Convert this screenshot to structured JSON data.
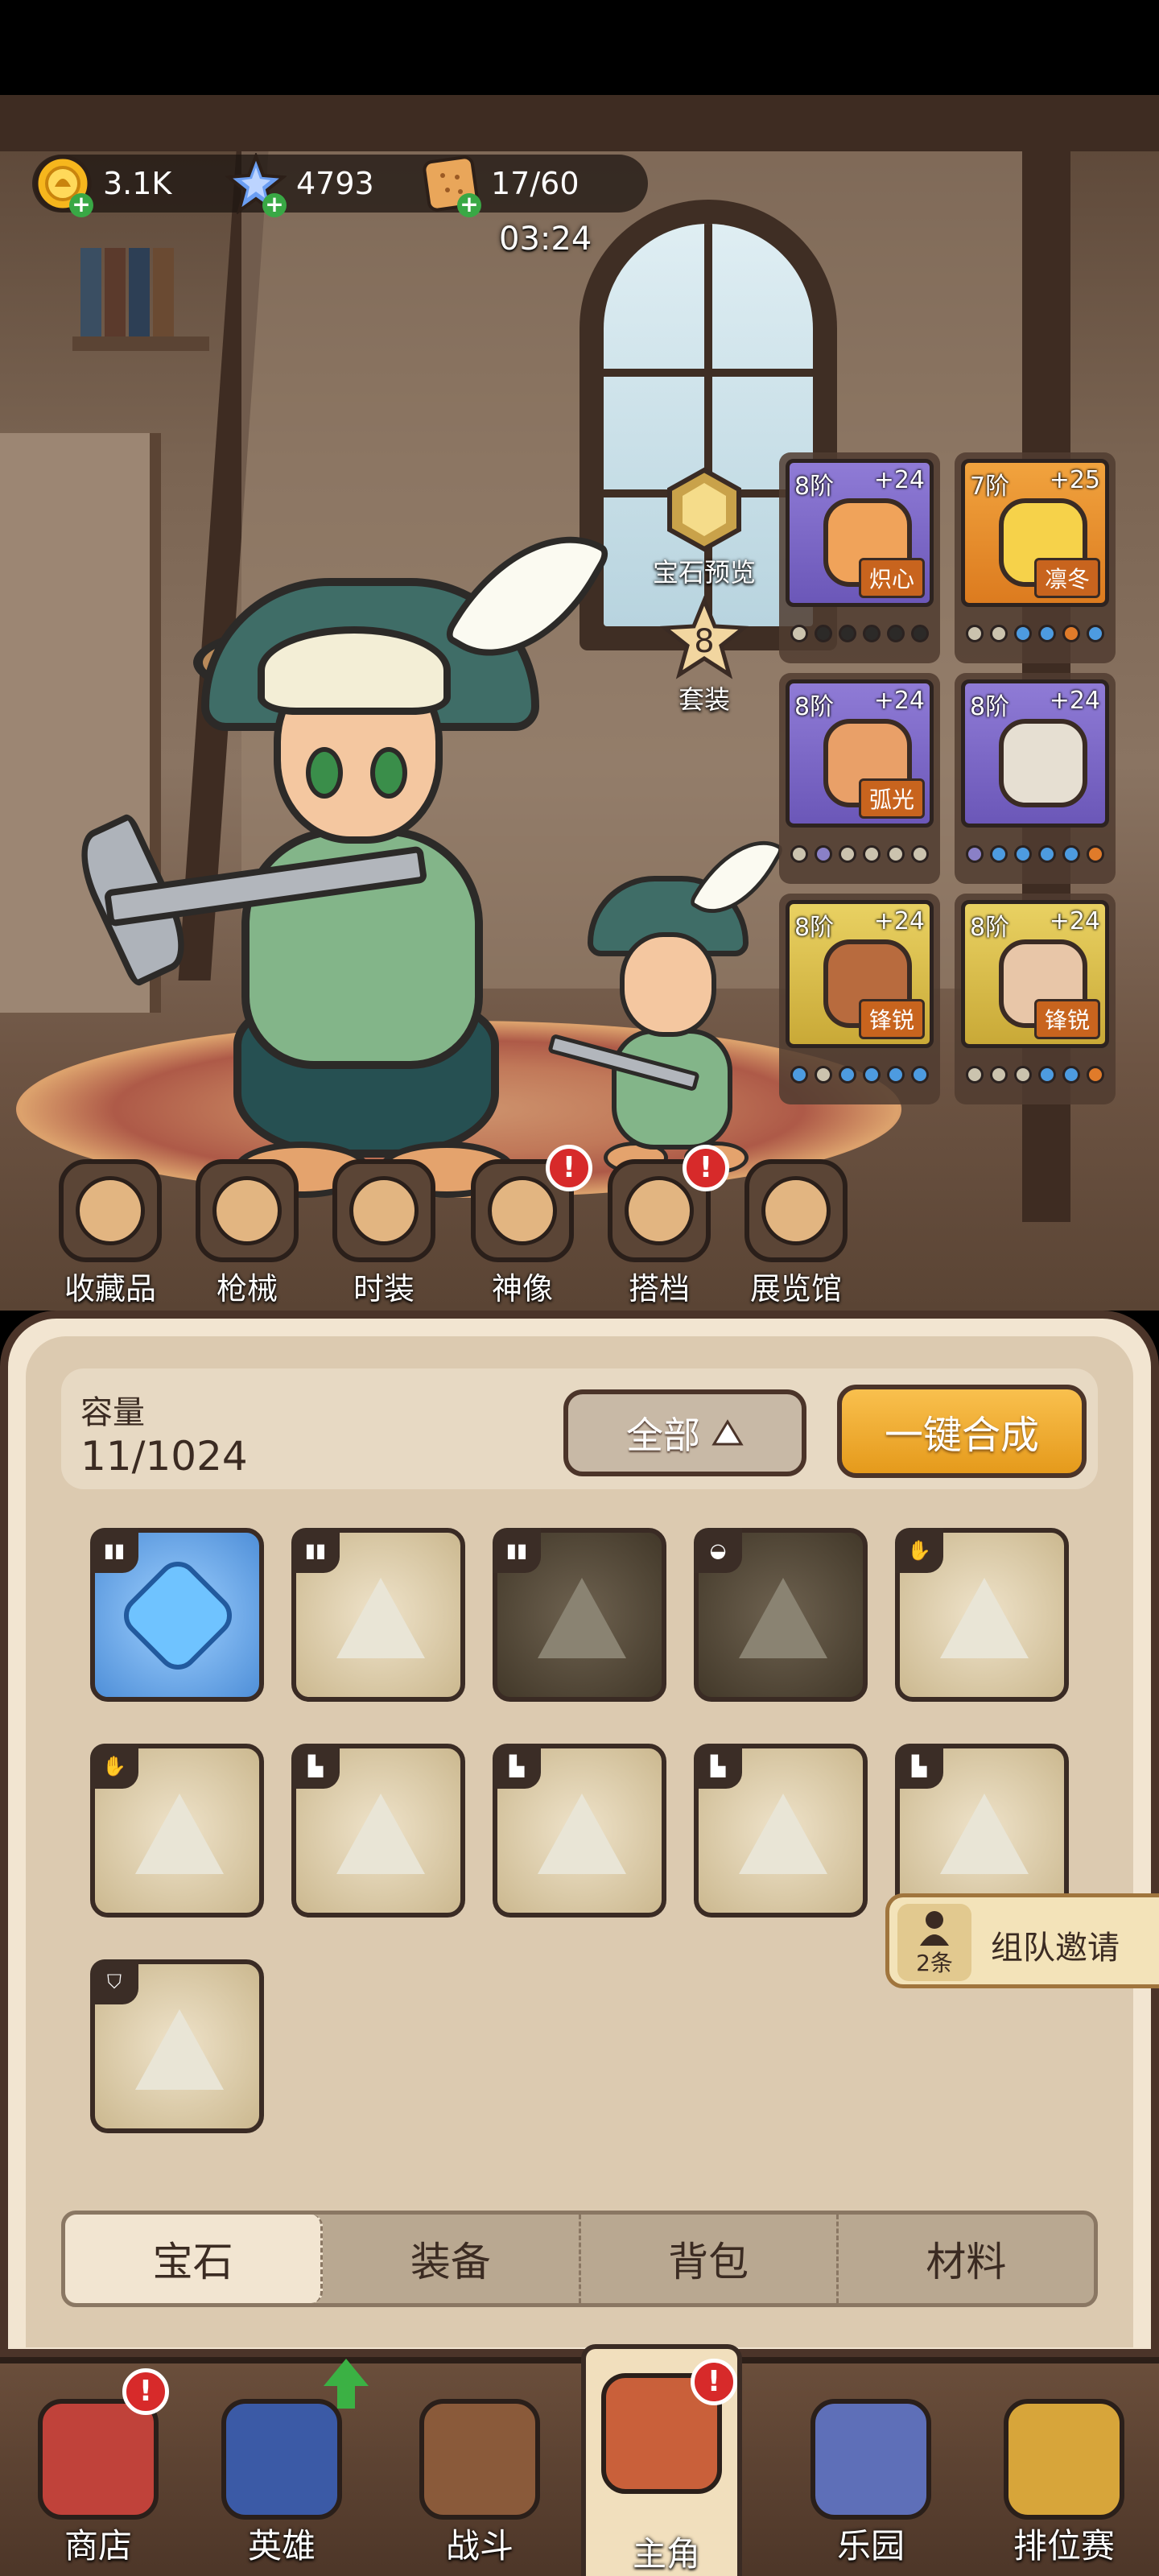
{
  "currency": {
    "gold": "3.1K",
    "stars": "4793",
    "stamina": "17/60",
    "timer": "03:24"
  },
  "side": {
    "gem_preview": "宝石预览",
    "set_count": "8",
    "set_label": "套装"
  },
  "equipment": [
    {
      "tier": "8阶",
      "level": "+24",
      "tag": "炽心",
      "frame": "purple",
      "item_color": "#f0a35a"
    },
    {
      "tier": "7阶",
      "level": "+25",
      "tag": "凛冬",
      "frame": "orange",
      "item_color": "#f6d24a"
    },
    {
      "tier": "8阶",
      "level": "+24",
      "tag": "弧光",
      "frame": "purple",
      "item_color": "#e9a068"
    },
    {
      "tier": "8阶",
      "level": "+24",
      "tag": "",
      "frame": "purple",
      "item_color": "#e6dfd2"
    },
    {
      "tier": "8阶",
      "level": "+24",
      "tag": "锋锐",
      "frame": "gold",
      "item_color": "#b86b3e"
    },
    {
      "tier": "8阶",
      "level": "+24",
      "tag": "锋锐",
      "frame": "gold",
      "item_color": "#e8c6a8"
    }
  ],
  "equipment_dots": [
    [
      "#cbc3ae",
      "#2c2a28",
      "#2c2a28",
      "#2c2a28",
      "#2c2a28",
      "#2c2a28"
    ],
    [
      "#cbc3ae",
      "#cbc3ae",
      "#4d9be0",
      "#4d9be0",
      "#e07b2a",
      "#4d9be0"
    ],
    [
      "#cbc3ae",
      "#8a80c6",
      "#cbc3ae",
      "#cbc3ae",
      "#cbc3ae",
      "#cbc3ae"
    ],
    [
      "#8a80c6",
      "#4d9be0",
      "#4d9be0",
      "#4d9be0",
      "#4d9be0",
      "#e07b2a"
    ],
    [
      "#4d9be0",
      "#cbc3ae",
      "#4d9be0",
      "#4d9be0",
      "#4d9be0",
      "#4d9be0"
    ],
    [
      "#cbc3ae",
      "#cbc3ae",
      "#cbc3ae",
      "#4d9be0",
      "#4d9be0",
      "#e07b2a"
    ]
  ],
  "features": [
    {
      "label": "收藏品",
      "icon": "collection-icon",
      "alert": false
    },
    {
      "label": "枪械",
      "icon": "gun-icon",
      "alert": false
    },
    {
      "label": "时装",
      "icon": "costume-icon",
      "alert": false
    },
    {
      "label": "神像",
      "icon": "statue-icon",
      "alert": true
    },
    {
      "label": "搭档",
      "icon": "partner-icon",
      "alert": true
    },
    {
      "label": "展览馆",
      "icon": "gallery-icon",
      "alert": false
    }
  ],
  "inventory": {
    "capacity_label": "容量",
    "capacity_value": "11/1024",
    "filter_label": "全部",
    "merge_label": "一键合成",
    "slots": [
      {
        "type": "pants-icon",
        "gem": "blue"
      },
      {
        "type": "pants-icon",
        "gem": "light"
      },
      {
        "type": "pants-icon",
        "gem": "dark"
      },
      {
        "type": "helmet-icon",
        "gem": "dark"
      },
      {
        "type": "glove-icon",
        "gem": "light"
      },
      {
        "type": "glove-icon",
        "gem": "light"
      },
      {
        "type": "boot-icon",
        "gem": "light"
      },
      {
        "type": "boot-icon",
        "gem": "light"
      },
      {
        "type": "boot-icon",
        "gem": "light"
      },
      {
        "type": "boot-icon",
        "gem": "light"
      },
      {
        "type": "armor-icon",
        "gem": "light"
      }
    ],
    "tabs": [
      "宝石",
      "装备",
      "背包",
      "材料"
    ],
    "active_tab": "宝石"
  },
  "invite": {
    "count": "2条",
    "label": "组队邀请"
  },
  "nav": [
    {
      "label": "商店",
      "icon": "shop-icon",
      "alert": true,
      "color": "#c0423a"
    },
    {
      "label": "英雄",
      "icon": "hero-cards-icon",
      "upgrade": true,
      "color": "#3b5aa6"
    },
    {
      "label": "战斗",
      "icon": "battle-icon",
      "color": "#8a5a3a"
    },
    {
      "label": "主角",
      "icon": "owl-icon",
      "alert": true,
      "active": true,
      "color": "#c9603a"
    },
    {
      "label": "乐园",
      "icon": "castle-icon",
      "color": "#5e6fb8"
    },
    {
      "label": "排位赛",
      "icon": "rank-badge-icon",
      "color": "#d7a53a"
    }
  ]
}
